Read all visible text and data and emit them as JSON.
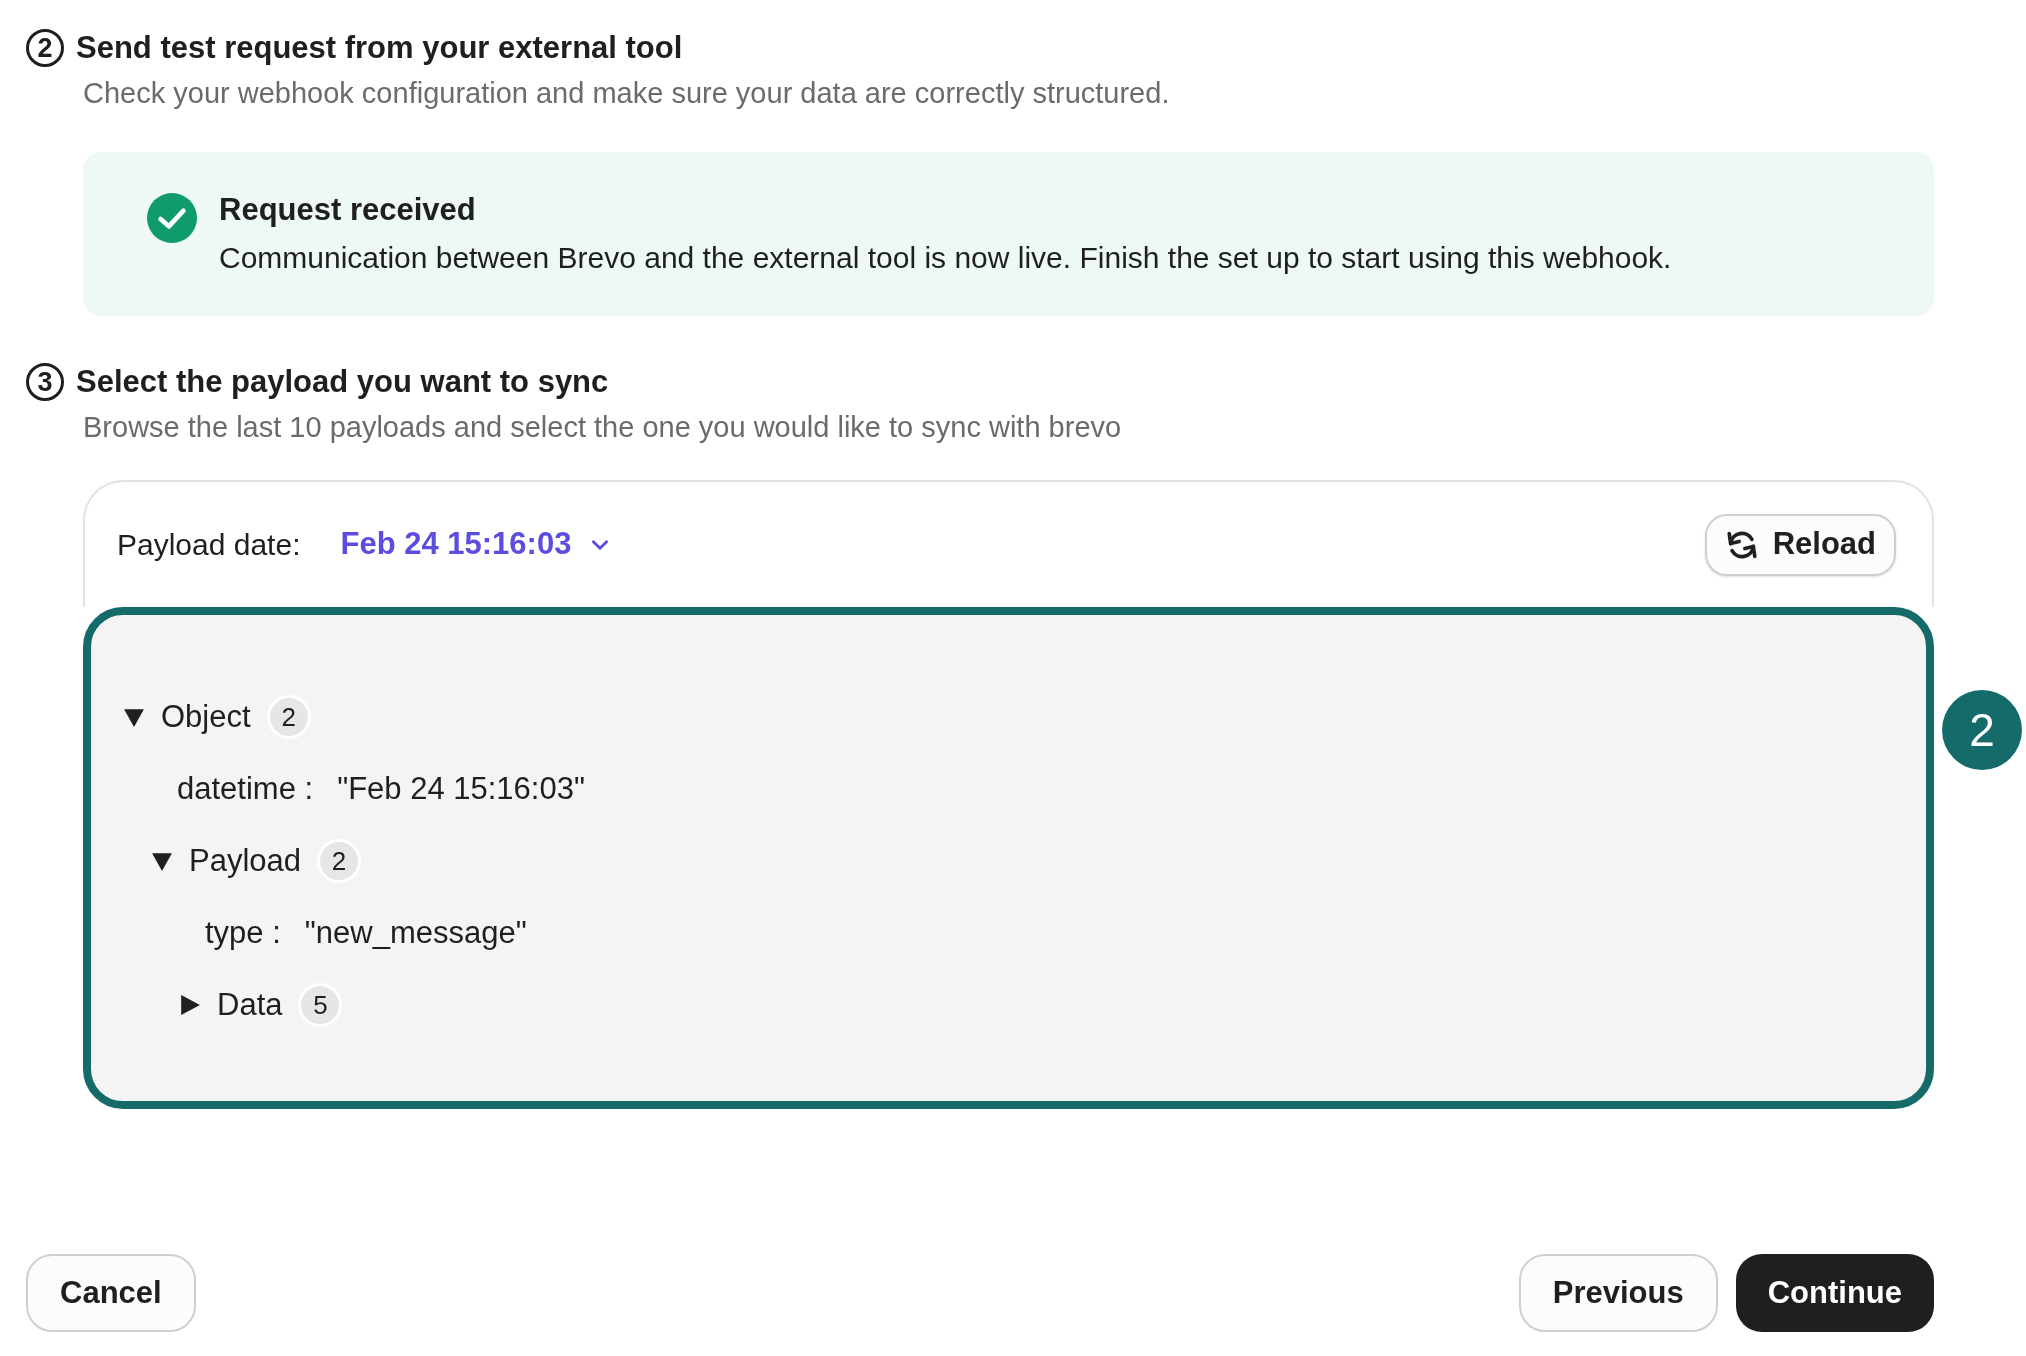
{
  "steps": [
    {
      "number": "2",
      "title": "Send test request from your external tool",
      "subtitle": "Check your webhook configuration and make sure your data are correctly structured."
    },
    {
      "number": "3",
      "title": "Select the payload you want to sync",
      "subtitle": "Browse the last 10 payloads and select the one you would like to sync with brevo"
    }
  ],
  "banner": {
    "title": "Request received",
    "message": "Communication between Brevo and the external tool is now live. Finish the set up to start using this webhook."
  },
  "payload_card": {
    "date_label": "Payload date:",
    "date_value": "Feb 24 15:16:03",
    "reload_button": "Reload",
    "tree": [
      {
        "kind": "object",
        "label": "Object",
        "count": "2",
        "expanded": true,
        "children": [
          {
            "kind": "field",
            "key": "datetime :",
            "value": "\"Feb 24 15:16:03\""
          },
          {
            "kind": "object",
            "label": "Payload",
            "count": "2",
            "expanded": true,
            "children": [
              {
                "kind": "field",
                "key": "type :",
                "value": "\"new_message\""
              },
              {
                "kind": "object",
                "label": "Data",
                "count": "5",
                "expanded": false
              }
            ]
          }
        ]
      }
    ]
  },
  "annotation": {
    "number": "2"
  },
  "footer": {
    "cancel": "Cancel",
    "previous": "Previous",
    "continue": "Continue"
  }
}
